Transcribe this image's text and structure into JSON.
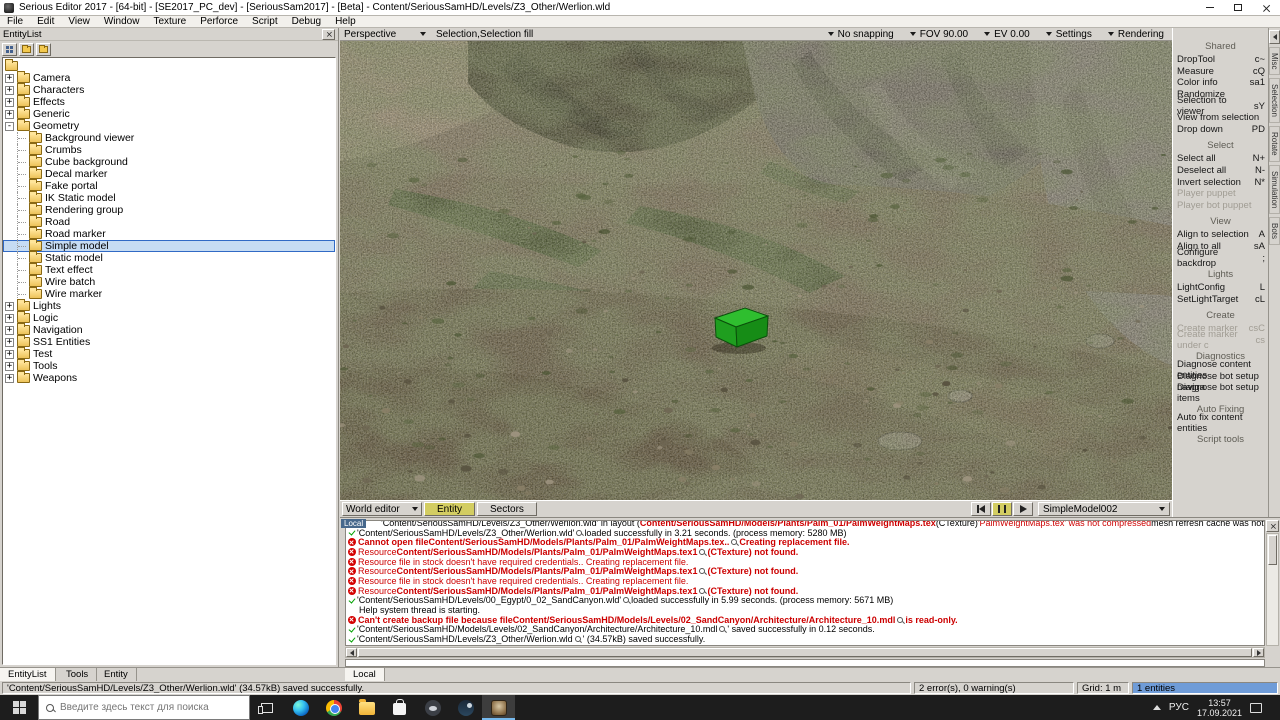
{
  "window": {
    "title": "Serious Editor 2017 - [64-bit] - [SE2017_PC_dev] - [SeriousSam2017] - [Beta] - Content/SeriousSamHD/Levels/Z3_Other/Werlion.wld",
    "menus": [
      "File",
      "Edit",
      "View",
      "Window",
      "Texture",
      "Perforce",
      "Script",
      "Debug",
      "Help"
    ],
    "controls": [
      "minimize",
      "maximize",
      "close"
    ]
  },
  "entity_panel": {
    "title": "EntityList",
    "toolbar_icons": [
      "list-view",
      "sync-folder",
      "new-folder"
    ],
    "tree": [
      {
        "label": "",
        "level": 0
      },
      {
        "label": "Camera",
        "level": 0,
        "exp": "+"
      },
      {
        "label": "Characters",
        "level": 0,
        "exp": "+"
      },
      {
        "label": "Effects",
        "level": 0,
        "exp": "+"
      },
      {
        "label": "Generic",
        "level": 0,
        "exp": "+"
      },
      {
        "label": "Geometry",
        "level": 0,
        "exp": "-"
      },
      {
        "label": "Background viewer",
        "level": 1
      },
      {
        "label": "Crumbs",
        "level": 1
      },
      {
        "label": "Cube background",
        "level": 1
      },
      {
        "label": "Decal marker",
        "level": 1
      },
      {
        "label": "Fake portal",
        "level": 1
      },
      {
        "label": "IK Static model",
        "level": 1
      },
      {
        "label": "Rendering group",
        "level": 1
      },
      {
        "label": "Road",
        "level": 1
      },
      {
        "label": "Road marker",
        "level": 1
      },
      {
        "label": "Simple model",
        "level": 1,
        "selected": true
      },
      {
        "label": "Static model",
        "level": 1
      },
      {
        "label": "Text effect",
        "level": 1
      },
      {
        "label": "Wire batch",
        "level": 1
      },
      {
        "label": "Wire marker",
        "level": 1
      },
      {
        "label": "Lights",
        "level": 0,
        "exp": "+"
      },
      {
        "label": "Logic",
        "level": 0,
        "exp": "+"
      },
      {
        "label": "Navigation",
        "level": 0,
        "exp": "+"
      },
      {
        "label": "SS1 Entities",
        "level": 0,
        "exp": "+"
      },
      {
        "label": "Test",
        "level": 0,
        "exp": "+"
      },
      {
        "label": "Tools",
        "level": 0,
        "exp": "+"
      },
      {
        "label": "Weapons",
        "level": 0,
        "exp": "+"
      }
    ]
  },
  "viewport": {
    "toolbar": {
      "view_mode": "Perspective",
      "selection_label": "Selection,Selection fill",
      "right_items": [
        "No snapping",
        "FOV 90.00",
        "EV  0.00",
        "Settings",
        "Rendering"
      ]
    },
    "bottom": {
      "editor_mode": "World editor",
      "tabs": [
        {
          "label": "Entity",
          "active": true
        },
        {
          "label": "Sectors",
          "active": false
        }
      ],
      "playback_icons": [
        "step-back",
        "pause",
        "play"
      ],
      "selected_entity": "SimpleModel002"
    },
    "selection_box_color_top": "#2fbe2f",
    "selection_box_color_side": "#1f9e1f"
  },
  "command_panel": {
    "sections": [
      {
        "title": "Shared",
        "items": [
          {
            "label": "DropTool",
            "shortcut": "c~"
          },
          {
            "label": "Measure",
            "shortcut": "cQ"
          },
          {
            "label": "Color info",
            "shortcut": "sa1"
          },
          {
            "label": "Randomize",
            "shortcut": ""
          },
          {
            "label": "Selection to viewer",
            "shortcut": "sY"
          },
          {
            "label": "View from selection",
            "shortcut": ""
          },
          {
            "label": "Drop down",
            "shortcut": "PD"
          }
        ]
      },
      {
        "title": "Select",
        "items": [
          {
            "label": "Select all",
            "shortcut": "N+"
          },
          {
            "label": "Deselect all",
            "shortcut": "N-"
          },
          {
            "label": "Invert selection",
            "shortcut": "N*"
          },
          {
            "label": "Player puppet",
            "shortcut": "",
            "disabled": true
          },
          {
            "label": "Player bot puppet",
            "shortcut": "",
            "disabled": true
          }
        ]
      },
      {
        "title": "View",
        "items": [
          {
            "label": "Align to selection",
            "shortcut": "A"
          },
          {
            "label": "Align to all",
            "shortcut": "sA"
          },
          {
            "label": "Configure backdrop",
            "shortcut": ";"
          }
        ]
      },
      {
        "title": "Lights",
        "items": [
          {
            "label": "LightConfig",
            "shortcut": "L"
          },
          {
            "label": "SetLightTarget",
            "shortcut": "cL"
          }
        ]
      },
      {
        "title": "Create",
        "items": [
          {
            "label": "Create marker",
            "shortcut": "csC",
            "disabled": true
          },
          {
            "label": "Create marker under c",
            "shortcut": "cs",
            "disabled": true
          }
        ]
      },
      {
        "title": "Diagnostics",
        "items": [
          {
            "label": "Diagnose content entities",
            "shortcut": ""
          },
          {
            "label": "Diagnose bot setup naviga",
            "shortcut": ""
          },
          {
            "label": "Diagnose bot setup items",
            "shortcut": ""
          }
        ]
      },
      {
        "title": "Auto Fixing",
        "items": [
          {
            "label": "Auto fix content entities",
            "shortcut": ""
          }
        ]
      },
      {
        "title": "Script tools",
        "items": []
      }
    ]
  },
  "side_tabs": [
    "Misc",
    "Selection",
    "Rotate",
    "Simulation",
    "Bots"
  ],
  "log_panel": {
    "tab": "Local",
    "partial_line": [
      {
        "t": "'Content/SeriousSamHD/Levels/Z3_Other/Werlion.wld' in layout (",
        "cls": "k"
      },
      {
        "t": "Content/SeriousSamHD/Models/Plants/Palm_01/PalmWeightMaps.tex",
        "cls": "rb"
      },
      {
        "t": " (CTexture) ",
        "cls": "k"
      },
      {
        "t": "'PalmWeightMaps.tex' was not compressed",
        "cls": "r"
      },
      {
        "t": " mesh refresh cache was not saved successfully...",
        "cls": "k"
      }
    ],
    "entries": [
      {
        "icon": "ok",
        "segs": [
          {
            "t": "'Content/SeriousSamHD/Levels/Z3_Other/Werlion.wld'",
            "cls": "k"
          },
          {
            "cls": "mag"
          },
          {
            "t": " loaded successfully in 3.21 seconds. (process memory: 5280 MB)",
            "cls": "k"
          }
        ]
      },
      {
        "icon": "err",
        "segs": [
          {
            "t": "Cannot open file ",
            "cls": "rb"
          },
          {
            "t": "Content/SeriousSamHD/Models/Plants/Palm_01/PalmWeightMaps.tex..",
            "cls": "rb"
          },
          {
            "cls": "mag"
          },
          {
            "t": " Creating replacement file.",
            "cls": "rb"
          }
        ]
      },
      {
        "icon": "err",
        "segs": [
          {
            "t": "Resource ",
            "cls": "r"
          },
          {
            "t": "Content/SeriousSamHD/Models/Plants/Palm_01/PalmWeightMaps.tex1 ",
            "cls": "rb"
          },
          {
            "cls": "mag"
          },
          {
            "t": " (CTexture) not found.",
            "cls": "rb"
          }
        ]
      },
      {
        "icon": "err",
        "segs": [
          {
            "t": "Resource file in stock doesn't have required credentials.. Creating replacement file.",
            "cls": "r"
          }
        ]
      },
      {
        "icon": "err",
        "segs": [
          {
            "t": "Resource ",
            "cls": "r"
          },
          {
            "t": "Content/SeriousSamHD/Models/Plants/Palm_01/PalmWeightMaps.tex1 ",
            "cls": "rb"
          },
          {
            "cls": "mag"
          },
          {
            "t": " (CTexture) not found.",
            "cls": "rb"
          }
        ]
      },
      {
        "icon": "err",
        "segs": [
          {
            "t": "Resource file in stock doesn't have required credentials.. Creating replacement file.",
            "cls": "r"
          }
        ]
      },
      {
        "icon": "err",
        "segs": [
          {
            "t": "Resource ",
            "cls": "r"
          },
          {
            "t": "Content/SeriousSamHD/Models/Plants/Palm_01/PalmWeightMaps.tex1 ",
            "cls": "rb"
          },
          {
            "cls": "mag"
          },
          {
            "t": " (CTexture) not found.",
            "cls": "rb"
          }
        ]
      },
      {
        "icon": "ok",
        "segs": [
          {
            "t": "'Content/SeriousSamHD/Levels/00_Egypt/0_02_SandCanyon.wld'",
            "cls": "k"
          },
          {
            "cls": "mag"
          },
          {
            "t": " loaded successfully in 5.99 seconds. (process memory: 5671 MB)",
            "cls": "k"
          }
        ]
      },
      {
        "icon": "none",
        "segs": [
          {
            "t": "Help system thread is starting.",
            "cls": "k"
          }
        ]
      },
      {
        "icon": "err",
        "segs": [
          {
            "t": "Can't create backup file because file ",
            "cls": "rb"
          },
          {
            "t": "Content/SeriousSamHD/Models/Levels/02_SandCanyon/Architecture/Architecture_10.mdl",
            "cls": "rb"
          },
          {
            "cls": "mag"
          },
          {
            "t": " is read-only.",
            "cls": "rb"
          }
        ]
      },
      {
        "icon": "ok",
        "segs": [
          {
            "t": "'Content/SeriousSamHD/Models/Levels/02_SandCanyon/Architecture/Architecture_10.mdl",
            "cls": "k"
          },
          {
            "cls": "mag"
          },
          {
            "t": "' saved successfully in 0.12 seconds.",
            "cls": "k"
          }
        ]
      },
      {
        "icon": "ok",
        "segs": [
          {
            "t": "'Content/SeriousSamHD/Levels/Z3_Other/Werlion.wld",
            "cls": "k"
          },
          {
            "cls": "mag"
          },
          {
            "t": "' (34.57kB) saved successfully.",
            "cls": "k"
          }
        ]
      }
    ]
  },
  "dock_tabs": [
    "EntityList",
    "Tools",
    "Entity"
  ],
  "status_bar": {
    "message": "'Content/SeriousSamHD/Levels/Z3_Other/Werlion.wld' (34.57kB) saved successfully.",
    "errors": "2 error(s), 0 warning(s)",
    "grid": "Grid: 1 m",
    "entities": "1 entities"
  },
  "taskbar": {
    "search_placeholder": "Введите здесь текст для поиска",
    "apps": [
      "edge",
      "chrome",
      "file-explorer",
      "microsoft-store",
      "discord",
      "steam",
      "serious-editor"
    ],
    "active_app": "serious-editor",
    "language": "РУС",
    "time": "13:57",
    "date": "17.09.2021"
  }
}
